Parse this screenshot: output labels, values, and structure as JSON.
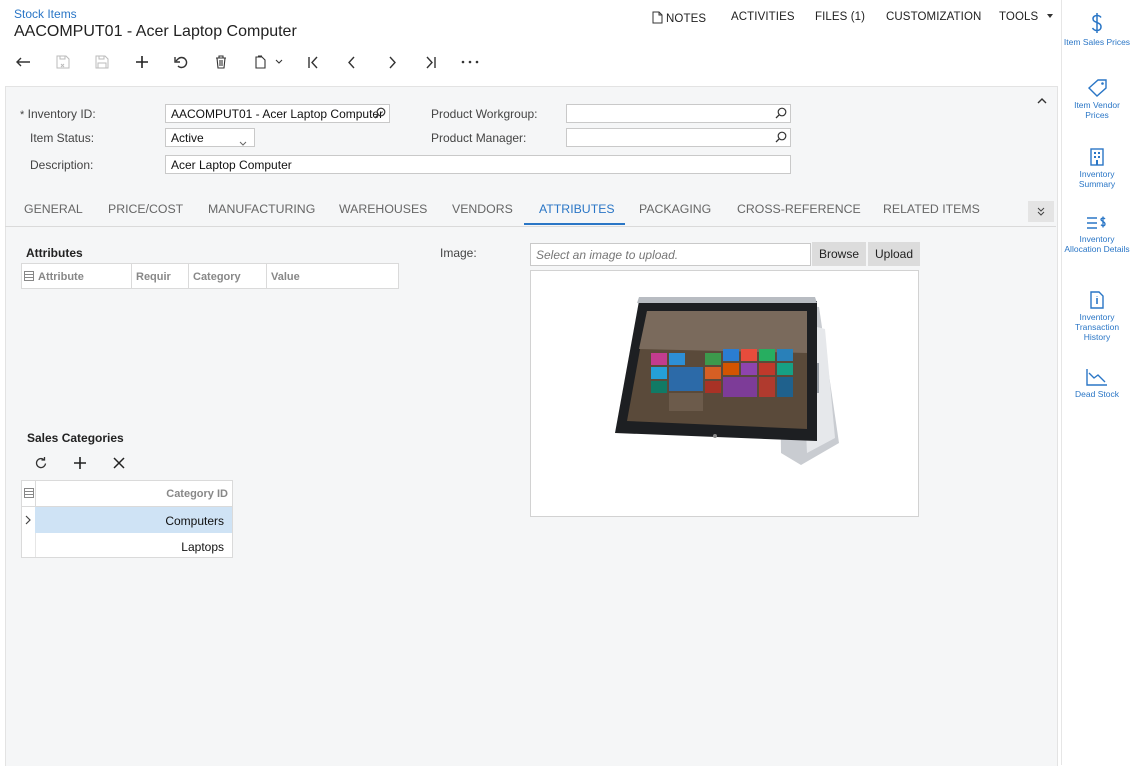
{
  "header": {
    "breadcrumb": "Stock Items",
    "title": "AACOMPUT01 - Acer Laptop Computer",
    "menu": {
      "notes": "NOTES",
      "activities": "ACTIVITIES",
      "files": "FILES (1)",
      "customization": "CUSTOMIZATION",
      "tools": "TOOLS"
    }
  },
  "toolbar": [
    "back-icon",
    "save-close-icon",
    "save-icon",
    "add-icon",
    "undo-icon",
    "delete-icon",
    "copy-paste-icon",
    "first-icon",
    "prev-icon",
    "next-icon",
    "last-icon",
    "more-icon"
  ],
  "form": {
    "inventory_id_label": "Inventory ID:",
    "inventory_id_value": "AACOMPUT01 - Acer Laptop Computer",
    "required_mark": "*",
    "item_status_label": "Item Status:",
    "item_status_value": "Active",
    "description_label": "Description:",
    "description_value": "Acer Laptop Computer",
    "product_workgroup_label": "Product Workgroup:",
    "product_workgroup_value": "",
    "product_manager_label": "Product Manager:",
    "product_manager_value": ""
  },
  "tabs": [
    "GENERAL",
    "PRICE/COST",
    "MANUFACTURING",
    "WAREHOUSES",
    "VENDORS",
    "ATTRIBUTES",
    "PACKAGING",
    "CROSS-REFERENCE",
    "RELATED ITEMS"
  ],
  "active_tab": "ATTRIBUTES",
  "attributes": {
    "title": "Attributes",
    "columns": [
      "Attribute",
      "Requir",
      "Category",
      "Value"
    ]
  },
  "sales_categories": {
    "title": "Sales Categories",
    "column": "Category ID",
    "rows": [
      "Computers",
      "Laptops"
    ]
  },
  "image": {
    "label": "Image:",
    "placeholder": "Select an image to upload.",
    "browse": "Browse",
    "upload": "Upload"
  },
  "sidebar": [
    {
      "label": "Item Sales Prices",
      "icon": "dollar-icon"
    },
    {
      "label": "Item Vendor Prices",
      "icon": "tag-icon"
    },
    {
      "label": "Inventory Summary",
      "icon": "building-icon"
    },
    {
      "label": "Inventory Allocation Details",
      "icon": "allocation-icon"
    },
    {
      "label": "Inventory Transaction History",
      "icon": "transaction-doc-icon"
    },
    {
      "label": "Dead Stock",
      "icon": "chart-down-icon"
    }
  ],
  "colors": {
    "accent": "#2a76c6",
    "selected_row": "#cfe3f5",
    "form_bg": "#f5f6f7"
  }
}
